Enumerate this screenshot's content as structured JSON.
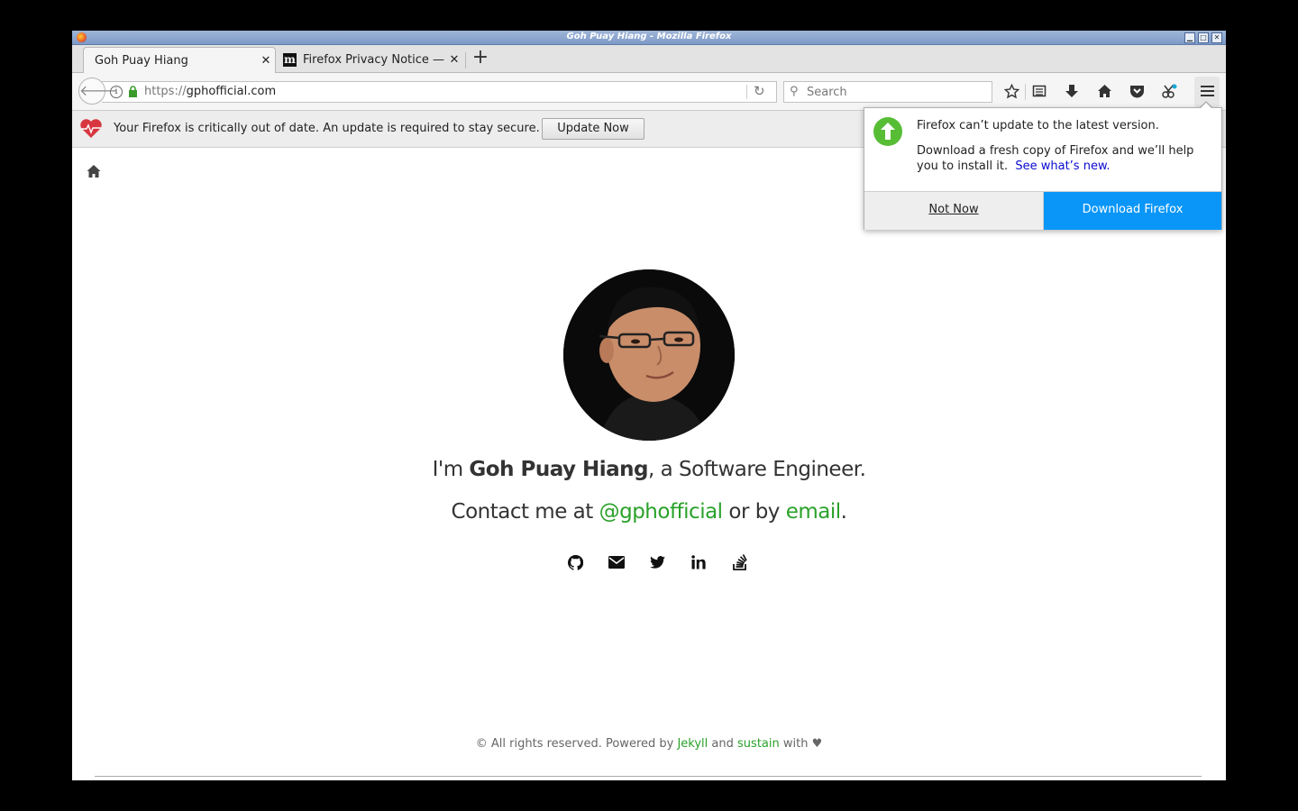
{
  "window": {
    "title": "Goh Puay Hiang - Mozilla Firefox",
    "controls": [
      "▁",
      "□",
      "✕"
    ]
  },
  "tabs": [
    {
      "label": "Goh Puay Hiang",
      "active": true
    },
    {
      "label": "Firefox Privacy Notice —",
      "active": false
    }
  ],
  "navbar": {
    "url_scheme": "https://",
    "url_host": "gphofficial.com",
    "search_placeholder": "Search"
  },
  "notification": {
    "message": "Your Firefox is critically out of date. An update is required to stay secure.",
    "button": "Update Now"
  },
  "popup": {
    "title": "Firefox can’t update to the latest version.",
    "body": "Download a fresh copy of Firefox and we’ll help you to install it.",
    "link": "See what’s new.",
    "not_now": "Not Now",
    "download": "Download Firefox"
  },
  "page": {
    "intro_prefix": "I'm ",
    "intro_name": "Goh Puay Hiang",
    "intro_suffix": ", a Software Engineer.",
    "contact_prefix": "Contact me at ",
    "contact_handle": "@gphofficial",
    "contact_mid": " or by ",
    "contact_email": "email",
    "contact_end": ".",
    "socials": [
      "github-icon",
      "envelope-icon",
      "twitter-icon",
      "linkedin-icon",
      "stackoverflow-icon"
    ]
  },
  "footer": {
    "prefix": "© All rights reserved. Powered by ",
    "jekyll": "Jekyll",
    "and": " and ",
    "sustain": "sustain",
    "suffix": " with ♥"
  },
  "colors": {
    "link_green": "#2aa12a",
    "download_blue": "#0996f8",
    "update_green": "#57bd35"
  }
}
